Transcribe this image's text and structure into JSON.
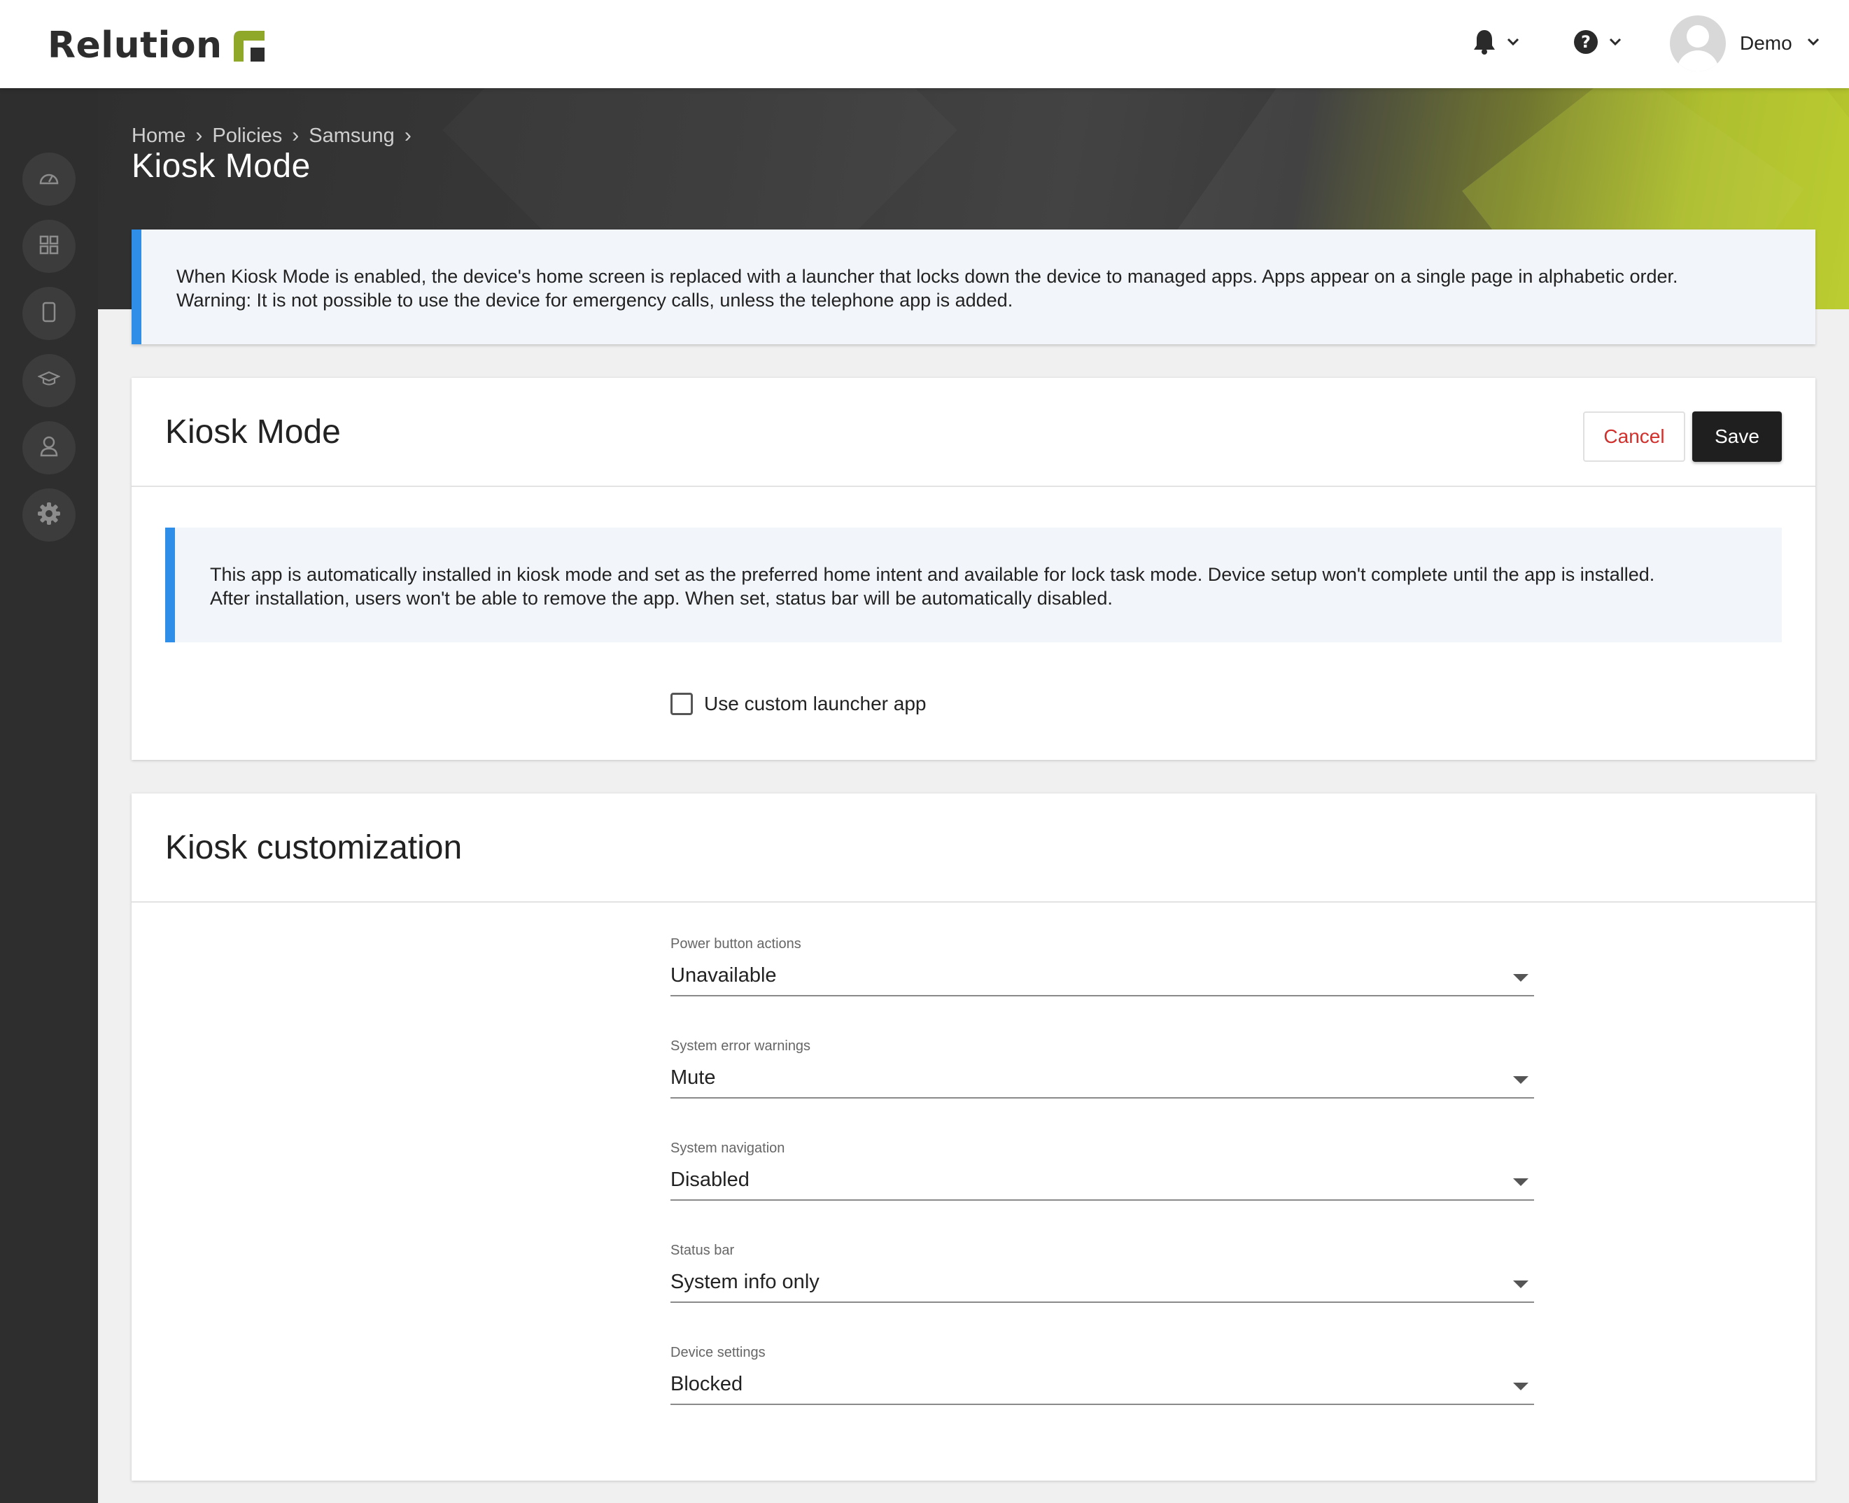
{
  "brand": {
    "name": "Relution",
    "accent": "#8fa82a"
  },
  "header": {
    "notifications_icon": "bell-icon",
    "help_icon": "question-circle-icon",
    "user_name": "Demo"
  },
  "sidebar": {
    "items": [
      {
        "icon": "dashboard-icon"
      },
      {
        "icon": "apps-grid-icon"
      },
      {
        "icon": "device-icon"
      },
      {
        "icon": "graduation-cap-icon"
      },
      {
        "icon": "user-icon"
      },
      {
        "icon": "gear-icon"
      }
    ]
  },
  "breadcrumb": {
    "items": [
      "Home",
      "Policies",
      "Samsung"
    ]
  },
  "page": {
    "title": "Kiosk Mode"
  },
  "info_top": {
    "line1": "When Kiosk Mode is enabled, the device's home screen is replaced with a launcher that locks down the device to managed apps. Apps appear on a single page in alphabetic order.",
    "line2": "Warning: It is not possible to use the device for emergency calls, unless the telephone app is added."
  },
  "kiosk_card": {
    "title": "Kiosk Mode",
    "cancel_label": "Cancel",
    "save_label": "Save",
    "info_line1": "This app is automatically installed in kiosk mode and set as the preferred home intent and available for lock task mode. Device setup won't complete until the app is installed.",
    "info_line2": "After installation, users won't be able to remove the app. When set, status bar will be automatically disabled.",
    "checkbox_label": "Use custom launcher app",
    "checkbox_checked": false
  },
  "custom_card": {
    "title": "Kiosk customization",
    "fields": [
      {
        "label": "Power button actions",
        "value": "Unavailable"
      },
      {
        "label": "System error warnings",
        "value": "Mute"
      },
      {
        "label": "System navigation",
        "value": "Disabled"
      },
      {
        "label": "Status bar",
        "value": "System info only"
      },
      {
        "label": "Device settings",
        "value": "Blocked"
      }
    ]
  }
}
